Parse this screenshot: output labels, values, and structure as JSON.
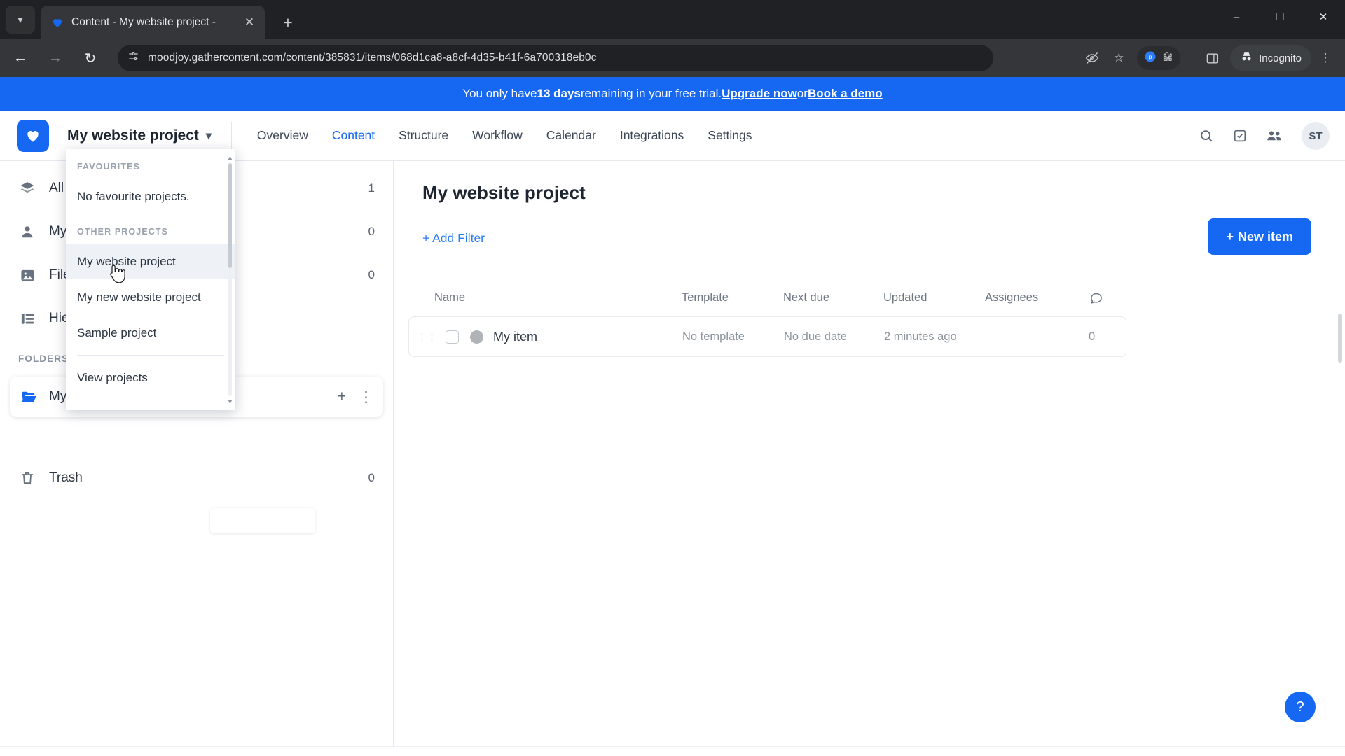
{
  "browser": {
    "tab": {
      "title": "Content - My website project -",
      "favicon_icon": "gathercontent-heart-icon",
      "close_icon": "close-icon"
    },
    "tabstrip_chevron_icon": "chevron-down-icon",
    "new_tab_icon": "plus-icon",
    "window_controls": {
      "minimize": "minimize-icon",
      "maximize": "maximize-icon",
      "close": "close-icon"
    },
    "nav": {
      "back_icon": "back-arrow-icon",
      "forward_icon": "forward-arrow-icon",
      "reload_icon": "reload-icon"
    },
    "omnibox": {
      "site_info_icon": "page-settings-icon",
      "url": "moodjoy.gathercontent.com/content/385831/items/068d1ca8-a8cf-4d35-b41f-6a700318eb0c"
    },
    "omnibox_icons": [
      "eye-slash-icon",
      "star-icon",
      "extension-puzzle-icon",
      "sidebar-icon"
    ],
    "incognito": {
      "label": "Incognito",
      "icon": "incognito-icon"
    },
    "menu_icon": "kebab-menu-icon"
  },
  "trial_banner": {
    "prefix": "You only have ",
    "days": "13 days",
    "middle": " remaining in your free trial. ",
    "upgrade_link": "Upgrade now",
    "or": " or ",
    "demo_link": "Book a demo"
  },
  "app_header": {
    "logo_icon": "gathercontent-logo-icon",
    "project_name": "My website project",
    "project_chevron_icon": "chevron-down-icon",
    "nav": [
      {
        "label": "Overview",
        "active": false
      },
      {
        "label": "Content",
        "active": true
      },
      {
        "label": "Structure",
        "active": false
      },
      {
        "label": "Workflow",
        "active": false
      },
      {
        "label": "Calendar",
        "active": false
      },
      {
        "label": "Integrations",
        "active": false
      },
      {
        "label": "Settings",
        "active": false
      }
    ],
    "right_icons": [
      "search-icon",
      "tasks-icon",
      "people-icon"
    ],
    "avatar_initials": "ST"
  },
  "project_dropdown": {
    "favourites_header": "FAVOURITES",
    "favourites_empty": "No favourite projects.",
    "other_header": "OTHER PROJECTS",
    "other_projects": [
      {
        "label": "My website project",
        "highlighted": true
      },
      {
        "label": "My new website project",
        "highlighted": false
      },
      {
        "label": "Sample project",
        "highlighted": false
      }
    ],
    "view_projects": "View projects",
    "scroll_up_icon": "caret-up-icon",
    "scroll_down_icon": "caret-down-icon"
  },
  "sidebar": {
    "items": [
      {
        "label": "All items",
        "count": "1",
        "icon": "layers-icon"
      },
      {
        "label": "My assignments",
        "count": "0",
        "icon": "person-icon"
      },
      {
        "label": "Files",
        "count": "0",
        "icon": "image-icon"
      },
      {
        "label": "Hierarchy",
        "count": "",
        "icon": "hierarchy-icon"
      }
    ],
    "folders_header": "FOLDERS",
    "folder": {
      "label": "My website project",
      "add_icon": "plus-icon",
      "more_icon": "kebab-menu-icon"
    },
    "trash": {
      "label": "Trash",
      "count": "0",
      "icon": "trash-icon"
    }
  },
  "main": {
    "title": "My website project",
    "add_filter": "+ Add Filter",
    "new_item_button": "New item",
    "new_item_icon": "plus-icon",
    "columns": [
      "Name",
      "Template",
      "Next due",
      "Updated",
      "Assignees"
    ],
    "comments_column_icon": "comment-icon",
    "rows": [
      {
        "drag_icon": "drag-handle-icon",
        "checkbox": "row-checkbox",
        "status_icon": "status-dot-icon",
        "name": "My item",
        "template": "No template",
        "next_due": "No due date",
        "updated": "2 minutes ago",
        "assignees": "",
        "comments": "0"
      }
    ],
    "help_button": "?"
  },
  "colors": {
    "accent": "#1668f2",
    "banner": "#1668f2",
    "link": "#2a7cf7",
    "chrome_dark": "#202124",
    "chrome_toolbar": "#35363a"
  }
}
